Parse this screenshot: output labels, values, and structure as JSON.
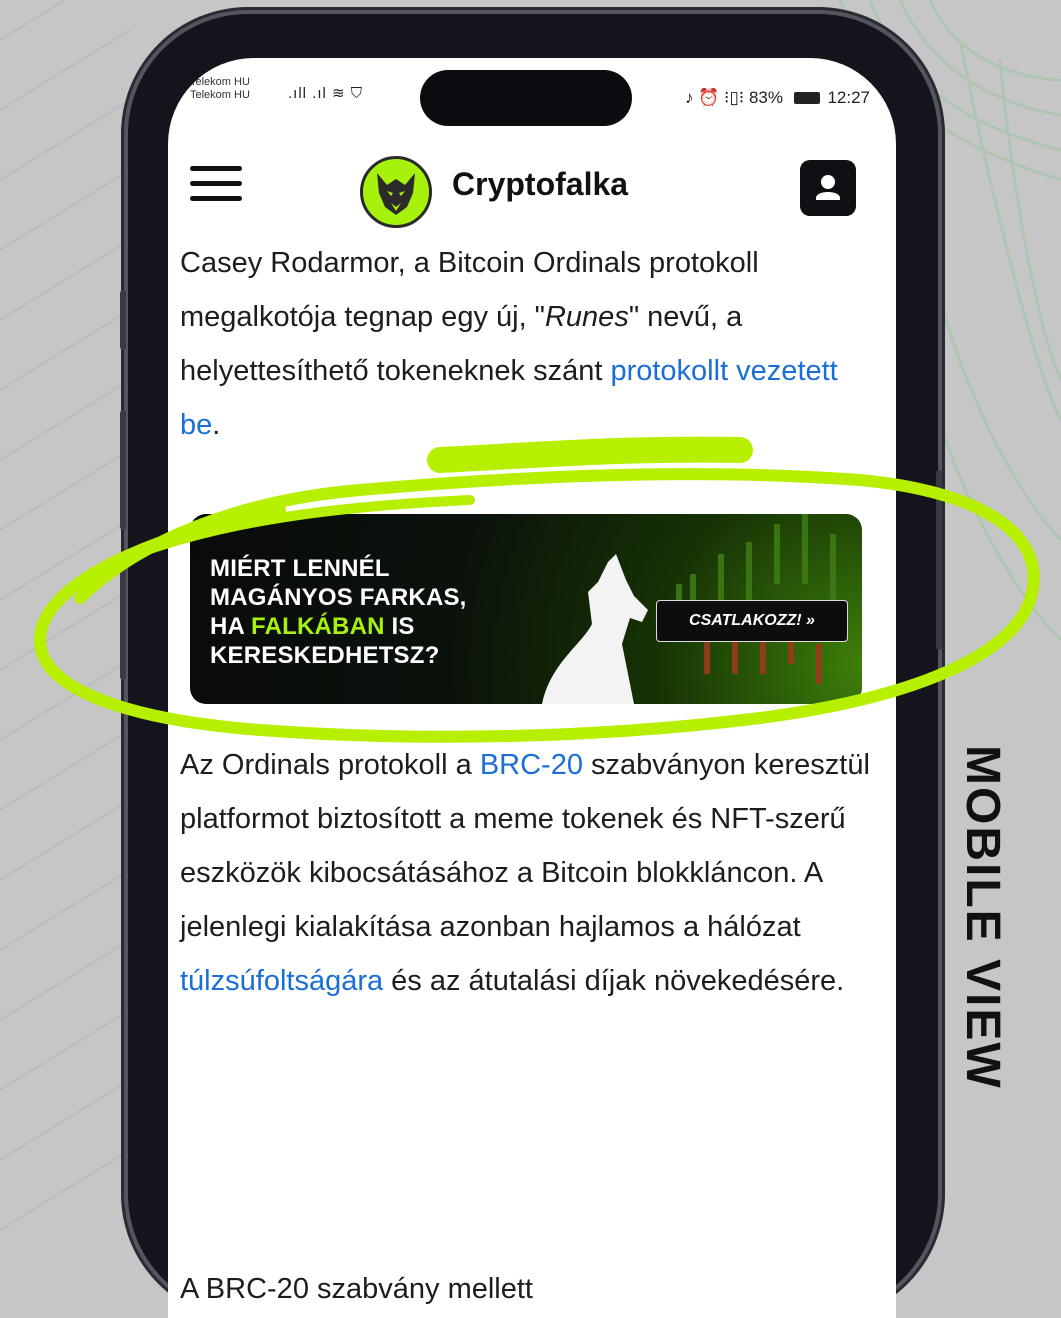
{
  "status_bar": {
    "carrier_1": "Telekom HU",
    "carrier_2": "Telekom HU",
    "signal_glyphs": ".ıll .ıl ≋ ⛉",
    "battery": "83%",
    "time": "12:27",
    "icons_text": "♪ ⏰ ⁝▯⁝"
  },
  "header": {
    "brand": "Cryptofalka",
    "menu_icon": "hamburger-icon",
    "user_icon": "user-icon",
    "logo_icon": "wolf-logo-icon"
  },
  "article": {
    "para1_a": "Casey Rodarmor, a Bitcoin Ordinals protokoll megalkotója tegnap egy új, \"",
    "para1_em": "Runes",
    "para1_b": "\" nevű, a helyettesíthető tokeneknek szánt ",
    "para1_link": "protokollt vezetett be",
    "para1_end": ".",
    "para2_a": "Az Ordinals protokoll a ",
    "para2_link1": "BRC-20",
    "para2_b": " szabványon keresztül platformot biztosított a meme tokenek és NFT-szerű eszközök kibocsátásához a Bitcoin blokkláncon. A jelenlegi kialakítása azonban hajlamos a hálózat ",
    "para2_link2": "túlzsúfoltságára",
    "para2_c": " és az átutalási díjak növekedésére.",
    "para3": "A BRC-20 szabvány mellett"
  },
  "banner": {
    "line1": "MIÉRT LENNÉL",
    "line2": "MAGÁNYOS FARKAS,",
    "line3_a": "HA ",
    "line3_hl": "FALKÁBAN",
    "line3_b": " IS",
    "line4": "KERESKEDHETSZ?",
    "cta": "CSATLAKOZZ! »"
  },
  "side_label": "MOBILE VIEW",
  "colors": {
    "accent_green": "#a6f20c",
    "link_blue": "#1a6fd6",
    "background": "#c6c6c6"
  }
}
